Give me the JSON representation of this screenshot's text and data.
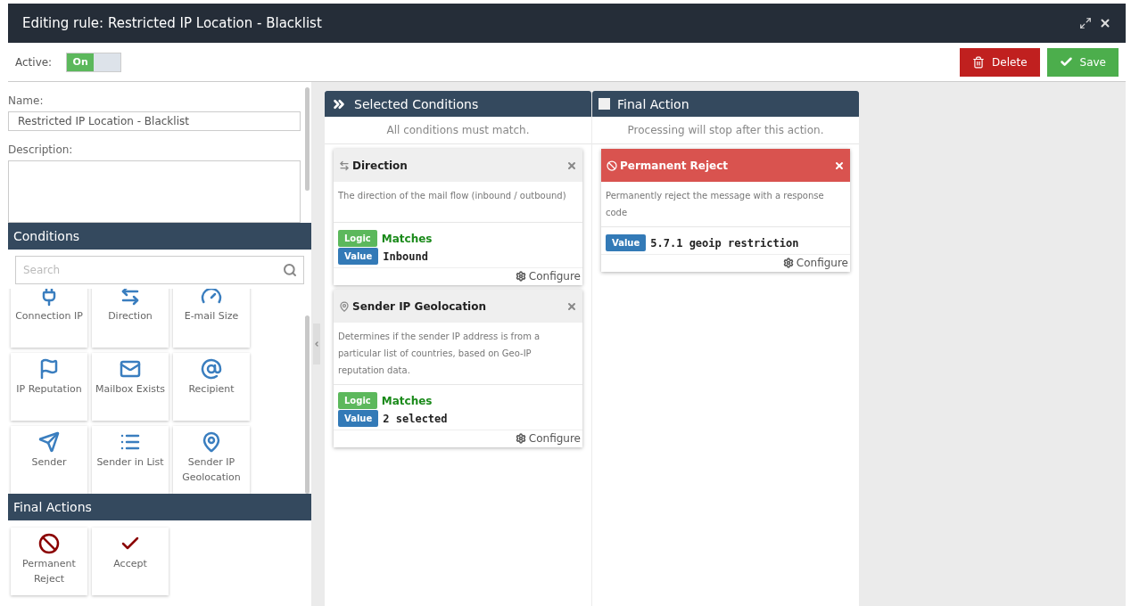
{
  "window": {
    "title": "Editing rule: Restricted IP Location - Blacklist"
  },
  "toolbar": {
    "active_label": "Active:",
    "active_toggle": {
      "label": "On",
      "on": true
    },
    "buttons": [
      {
        "kind": "delete",
        "label": "Delete"
      },
      {
        "kind": "save",
        "label": "Save"
      }
    ]
  },
  "form": {
    "name_label": "Name:",
    "name_value": "Restricted IP Location - Blacklist",
    "description_label": "Description:"
  },
  "conditions_panel": {
    "title": "Conditions",
    "search": {
      "placeholder": "Search"
    },
    "items": [
      {
        "kind": "plug",
        "label": "Connection IP"
      },
      {
        "kind": "arrows",
        "label": "Direction"
      },
      {
        "kind": "gauge",
        "label": "E-mail Size"
      },
      {
        "kind": "flag",
        "label": "IP Reputation"
      },
      {
        "kind": "mail",
        "label": "Mailbox Exists"
      },
      {
        "kind": "at",
        "label": "Recipient"
      },
      {
        "kind": "send",
        "label": "Sender"
      },
      {
        "kind": "list",
        "label": "Sender in List"
      },
      {
        "kind": "pin",
        "label": "Sender IP Geolocation"
      }
    ]
  },
  "final_actions_panel": {
    "title": "Final Actions",
    "items": [
      {
        "kind": "ban",
        "label": "Permanent Reject"
      },
      {
        "kind": "check",
        "label": "Accept"
      }
    ]
  },
  "selected_conditions": {
    "title": "Selected Conditions",
    "note": "All conditions must match.",
    "cards": [
      {
        "kind": "arrows",
        "title": "Direction",
        "description": "The direction of the mail flow (inbound / outbound)",
        "logic_label": "Logic",
        "logic": "Matches",
        "value_label": "Value",
        "value": "Inbound",
        "configure": "Configure"
      },
      {
        "kind": "pin",
        "title": "Sender IP Geolocation",
        "description": "Determines if the sender IP address is from a particular list of countries, based on Geo-IP reputation data.",
        "logic_label": "Logic",
        "logic": "Matches",
        "value_label": "Value",
        "value": "2 selected",
        "configure": "Configure"
      }
    ]
  },
  "final_action": {
    "title": "Final Action",
    "checked": false,
    "note": "Processing will stop after this action.",
    "cards": [
      {
        "kind": "ban",
        "title": "Permanent Reject",
        "description": "Permanently reject the message with a response code",
        "value_label": "Value",
        "value": "5.7.1 geoip restriction",
        "configure": "Configure"
      }
    ]
  }
}
